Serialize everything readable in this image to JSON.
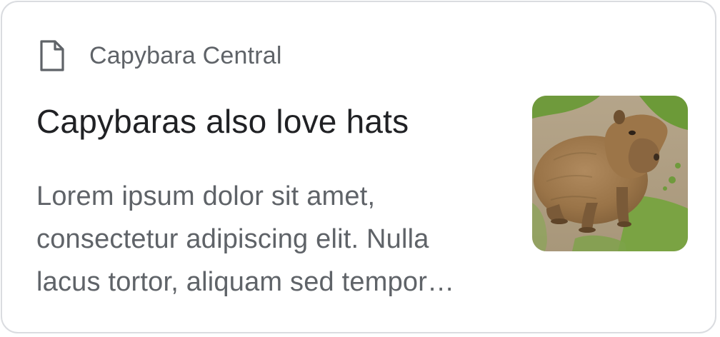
{
  "card": {
    "source": {
      "icon": "document-icon",
      "name": "Capybara Central"
    },
    "headline": "Capybaras also love hats",
    "snippet": "Lorem ipsum dolor sit amet, consectetur adipiscing elit. Nulla lacus tortor, aliquam sed tempor…",
    "thumbnail": {
      "alt": "capybara-photo"
    }
  },
  "colors": {
    "border": "#dadce0",
    "headline": "#202124",
    "secondary_text": "#5f6368"
  }
}
